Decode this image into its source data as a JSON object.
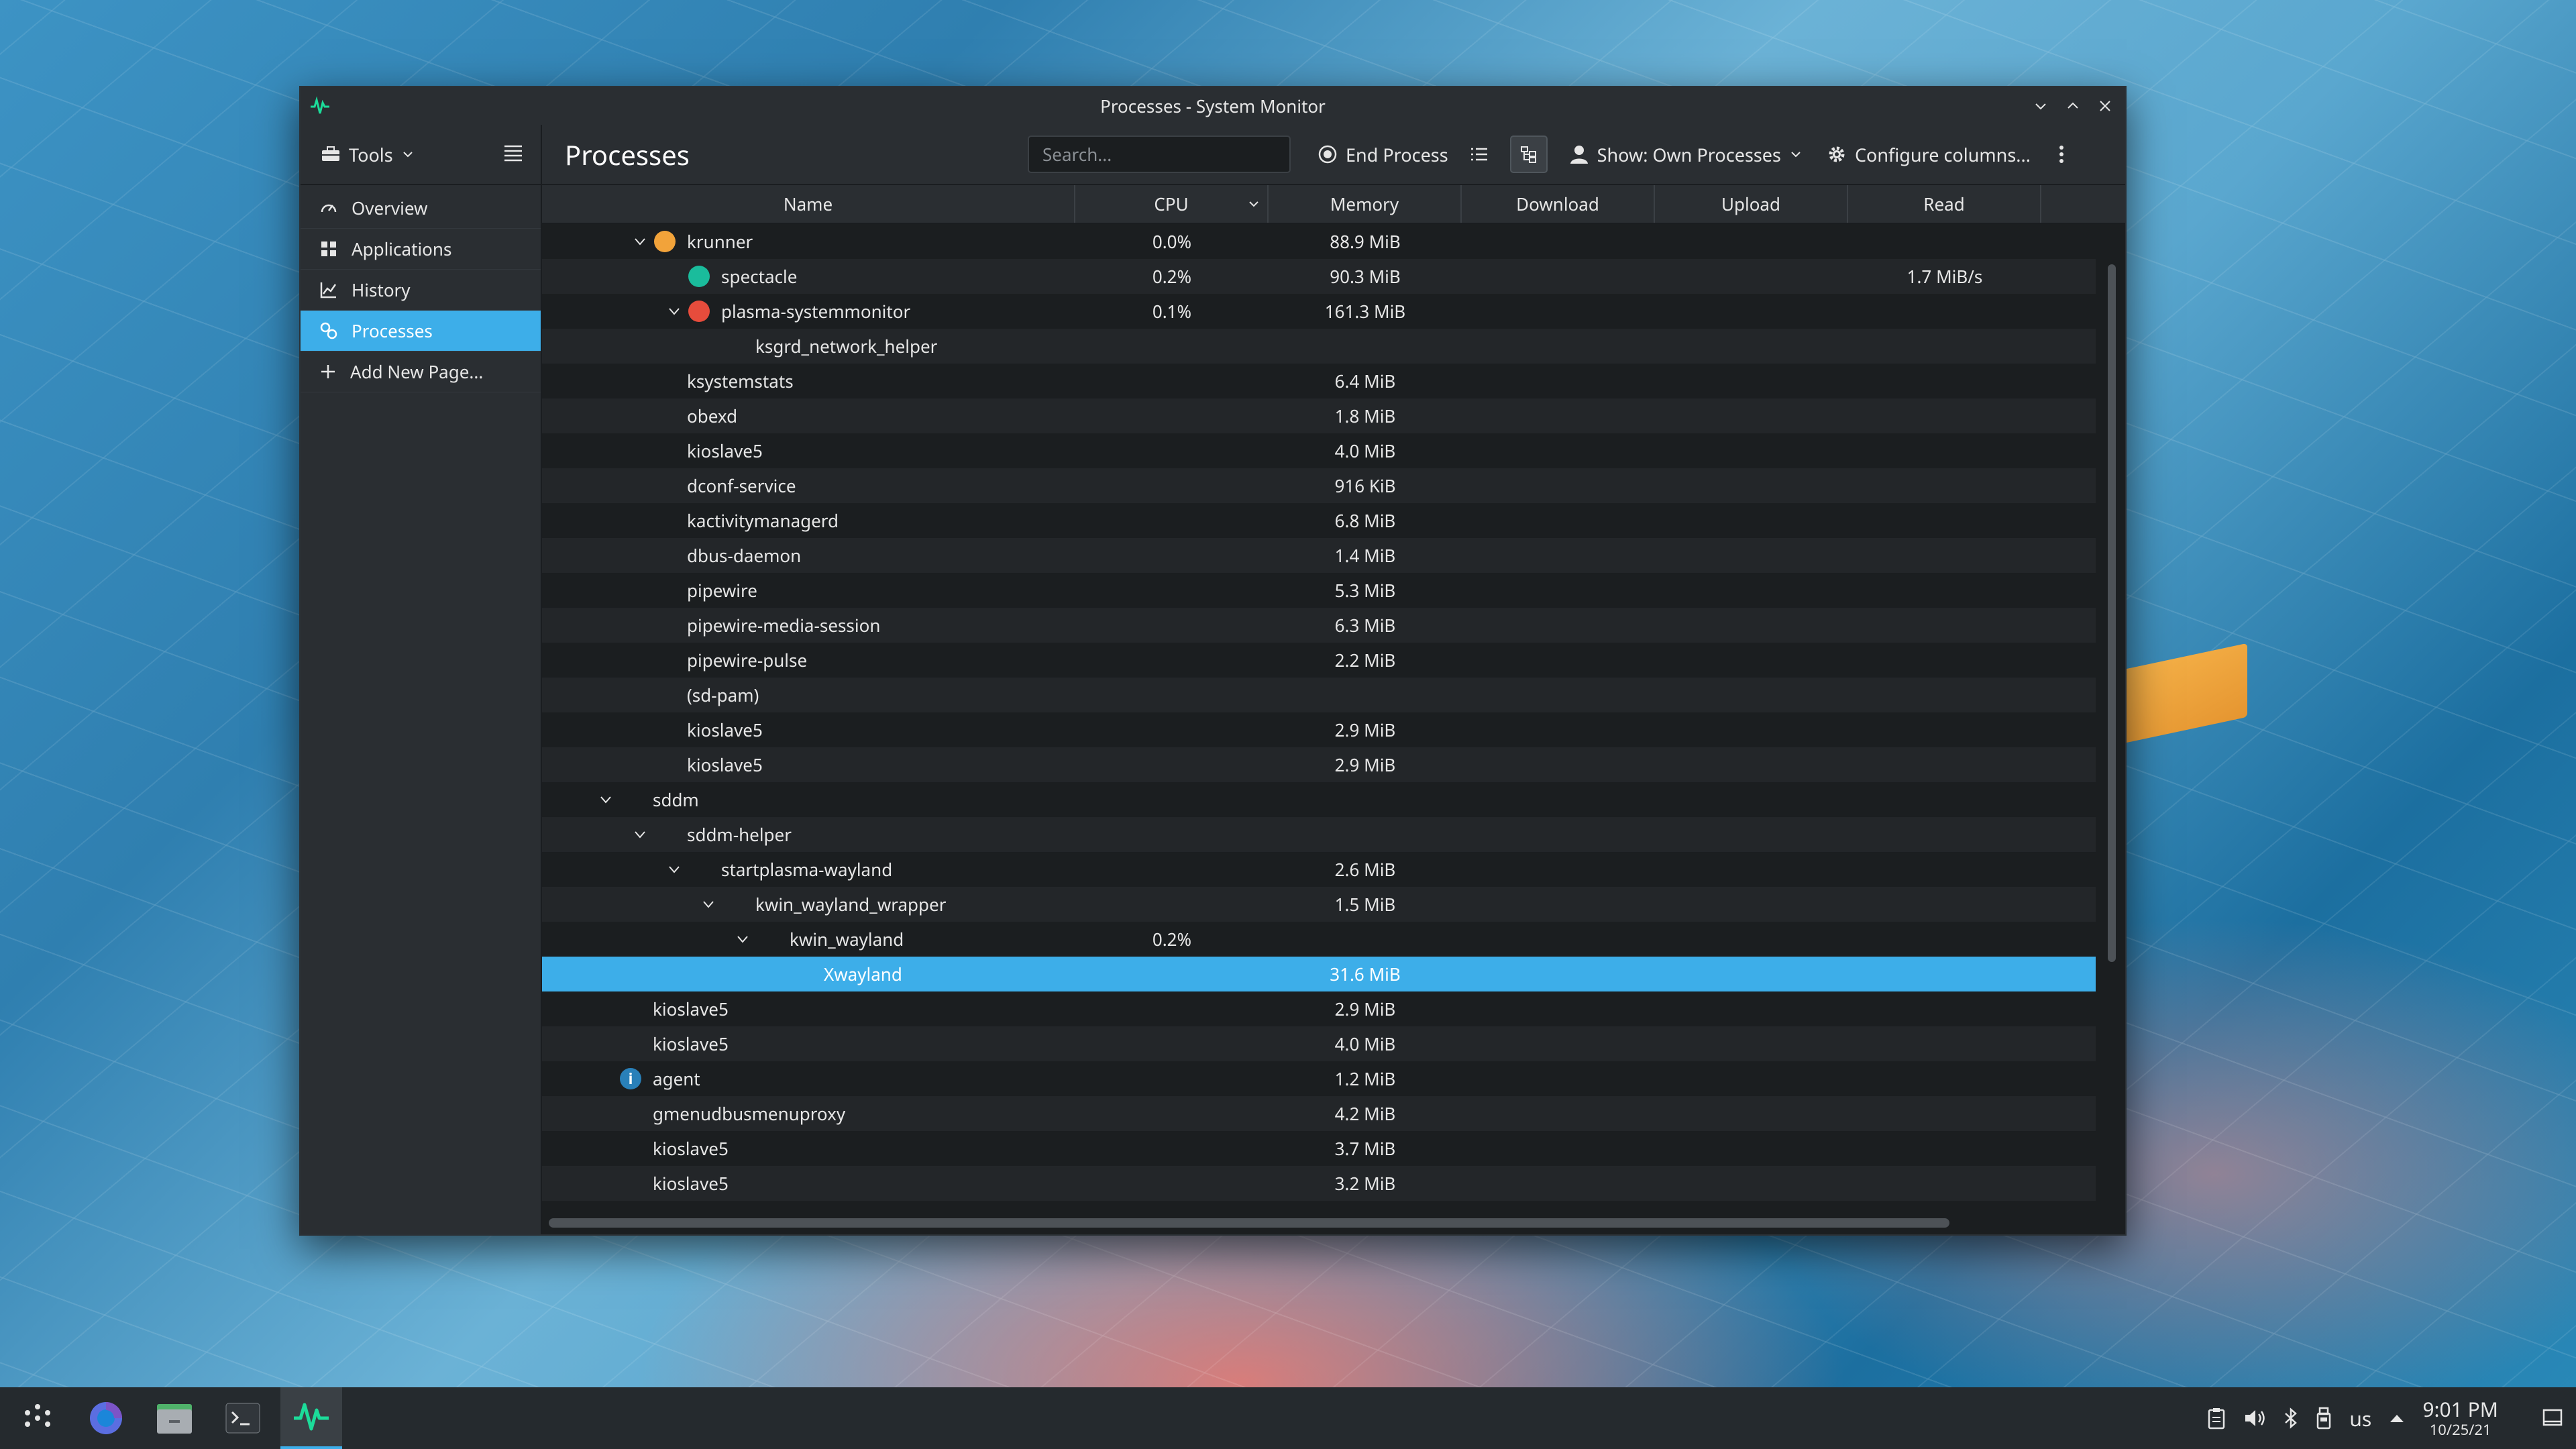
{
  "window": {
    "title": "Processes - System Monitor"
  },
  "toolbar": {
    "tools_label": "Tools",
    "page_title": "Processes",
    "search_placeholder": "Search...",
    "end_process_label": "End Process",
    "show_filter_label": "Show: Own Processes",
    "configure_columns_label": "Configure columns..."
  },
  "sidebar": {
    "items": [
      {
        "label": "Overview",
        "icon": "overview-icon"
      },
      {
        "label": "Applications",
        "icon": "applications-grid-icon"
      },
      {
        "label": "History",
        "icon": "chart-icon"
      },
      {
        "label": "Processes",
        "icon": "processes-icon",
        "selected": true
      },
      {
        "label": "Add New Page...",
        "icon": "plus-icon"
      }
    ]
  },
  "columns": [
    "Name",
    "CPU",
    "Memory",
    "Download",
    "Upload",
    "Read"
  ],
  "rows": [
    {
      "name": "krunner",
      "cpu": "0.0%",
      "memory": "88.9 MiB",
      "read": ""
    },
    {
      "name": "spectacle",
      "cpu": "0.2%",
      "memory": "90.3 MiB",
      "read": "1.7 MiB/s"
    },
    {
      "name": "plasma-systemmonitor",
      "cpu": "0.1%",
      "memory": "161.3 MiB",
      "read": ""
    },
    {
      "name": "ksgrd_network_helper",
      "cpu": "",
      "memory": "",
      "read": ""
    },
    {
      "name": "ksystemstats",
      "cpu": "",
      "memory": "6.4 MiB",
      "read": ""
    },
    {
      "name": "obexd",
      "cpu": "",
      "memory": "1.8 MiB",
      "read": ""
    },
    {
      "name": "kioslave5",
      "cpu": "",
      "memory": "4.0 MiB",
      "read": ""
    },
    {
      "name": "dconf-service",
      "cpu": "",
      "memory": "916 KiB",
      "read": ""
    },
    {
      "name": "kactivitymanagerd",
      "cpu": "",
      "memory": "6.8 MiB",
      "read": ""
    },
    {
      "name": "dbus-daemon",
      "cpu": "",
      "memory": "1.4 MiB",
      "read": ""
    },
    {
      "name": "pipewire",
      "cpu": "",
      "memory": "5.3 MiB",
      "read": ""
    },
    {
      "name": "pipewire-media-session",
      "cpu": "",
      "memory": "6.3 MiB",
      "read": ""
    },
    {
      "name": "pipewire-pulse",
      "cpu": "",
      "memory": "2.2 MiB",
      "read": ""
    },
    {
      "name": "(sd-pam)",
      "cpu": "",
      "memory": "",
      "read": ""
    },
    {
      "name": "kioslave5",
      "cpu": "",
      "memory": "2.9 MiB",
      "read": ""
    },
    {
      "name": "kioslave5",
      "cpu": "",
      "memory": "2.9 MiB",
      "read": ""
    },
    {
      "name": "sddm",
      "cpu": "",
      "memory": "",
      "read": ""
    },
    {
      "name": "sddm-helper",
      "cpu": "",
      "memory": "",
      "read": ""
    },
    {
      "name": "startplasma-wayland",
      "cpu": "",
      "memory": "2.6 MiB",
      "read": ""
    },
    {
      "name": "kwin_wayland_wrapper",
      "cpu": "",
      "memory": "1.5 MiB",
      "read": ""
    },
    {
      "name": "kwin_wayland",
      "cpu": "0.2%",
      "memory": "",
      "read": ""
    },
    {
      "name": "Xwayland",
      "cpu": "",
      "memory": "31.6 MiB",
      "read": "",
      "selected": true
    },
    {
      "name": "kioslave5",
      "cpu": "",
      "memory": "2.9 MiB",
      "read": ""
    },
    {
      "name": "kioslave5",
      "cpu": "",
      "memory": "4.0 MiB",
      "read": ""
    },
    {
      "name": "agent",
      "cpu": "",
      "memory": "1.2 MiB",
      "read": ""
    },
    {
      "name": "gmenudbusmenuproxy",
      "cpu": "",
      "memory": "4.2 MiB",
      "read": ""
    },
    {
      "name": "kioslave5",
      "cpu": "",
      "memory": "3.7 MiB",
      "read": ""
    },
    {
      "name": "kioslave5",
      "cpu": "",
      "memory": "3.2 MiB",
      "read": ""
    }
  ],
  "tray": {
    "keyboard_layout": "us",
    "time": "9:01 PM",
    "date": "10/25/21"
  },
  "colors": {
    "accent": "#3daee9",
    "window_bg": "#1b1e20",
    "panel_bg": "#2a2e32"
  }
}
